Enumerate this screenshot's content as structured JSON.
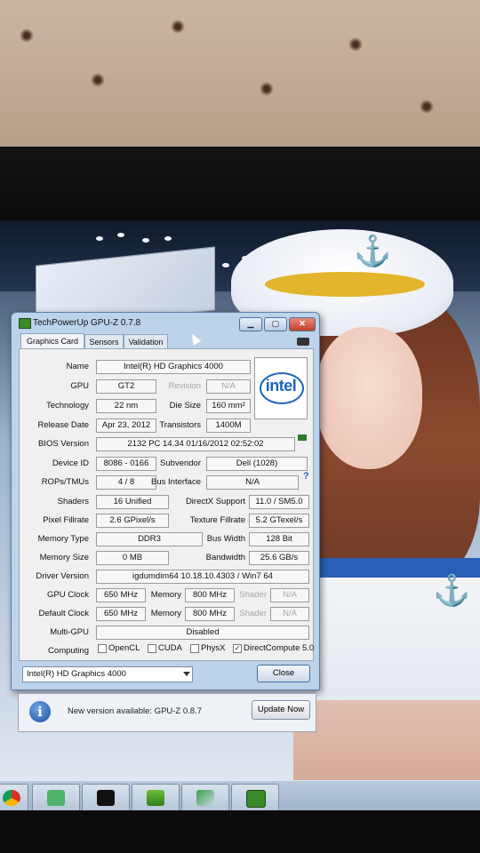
{
  "window": {
    "title": "TechPowerUp GPU-Z 0.7.8",
    "buttons": {
      "minimize": "▁",
      "maximize": "▢",
      "close": "✕"
    }
  },
  "tabs": [
    "Graphics Card",
    "Sensors",
    "Validation"
  ],
  "graphics_card": {
    "name_label": "Name",
    "name": "Intel(R) HD Graphics 4000",
    "gpu_label": "GPU",
    "gpu": "GT2",
    "revision_label": "Revision",
    "revision": "N/A",
    "technology_label": "Technology",
    "technology": "22 nm",
    "die_size_label": "Die Size",
    "die_size": "160 mm²",
    "release_date_label": "Release Date",
    "release_date": "Apr 23, 2012",
    "transistors_label": "Transistors",
    "transistors": "1400M",
    "bios_label": "BIOS Version",
    "bios": "2132 PC 14.34 01/16/2012 02:52:02",
    "device_id_label": "Device ID",
    "device_id": "8086 - 0166",
    "subvendor_label": "Subvendor",
    "subvendor": "Dell (1028)",
    "rops_label": "ROPs/TMUs",
    "rops": "4 / 8",
    "bus_label": "Bus Interface",
    "bus": "N/A",
    "shaders_label": "Shaders",
    "shaders": "16 Unified",
    "directx_label": "DirectX Support",
    "directx": "11.0 / SM5.0",
    "pixel_fillrate_label": "Pixel Fillrate",
    "pixel_fillrate": "2.6 GPixel/s",
    "texture_fillrate_label": "Texture Fillrate",
    "texture_fillrate": "5.2 GTexel/s",
    "memory_type_label": "Memory Type",
    "memory_type": "DDR3",
    "bus_width_label": "Bus Width",
    "bus_width": "128 Bit",
    "memory_size_label": "Memory Size",
    "memory_size": "0 MB",
    "bandwidth_label": "Bandwidth",
    "bandwidth": "25.6 GB/s",
    "driver_label": "Driver Version",
    "driver": "igdumdim64 10.18.10.4303 / Win7 64",
    "gpu_clock_label": "GPU Clock",
    "gpu_clock": "650 MHz",
    "memory_label": "Memory",
    "memory_clock": "800 MHz",
    "shader_label": "Shader",
    "shader_clock": "N/A",
    "default_clock_label": "Default Clock",
    "default_clock": "650 MHz",
    "default_memory_clock": "800 MHz",
    "default_shader_clock": "N/A",
    "multigpu_label": "Multi-GPU",
    "multigpu": "Disabled",
    "computing_label": "Computing",
    "opencl_label": "OpenCL",
    "opencl_checked": false,
    "cuda_label": "CUDA",
    "cuda_checked": false,
    "physx_label": "PhysX",
    "physx_checked": false,
    "directcompute_label": "DirectCompute 5.0",
    "directcompute_checked": true,
    "check_mark": "✓",
    "vendor_logo_text": "intel"
  },
  "footer": {
    "selected_gpu": "Intel(R) HD Graphics 4000",
    "close_label": "Close"
  },
  "notification": {
    "icon_glyph": "i",
    "text": "New version available: GPU-Z 0.8.7",
    "button": "Update Now"
  },
  "taskbar": {
    "items": [
      "chrome-icon",
      "folder-icon",
      "console-icon",
      "download-icon",
      "tool-icon",
      "gpu-z-icon"
    ]
  },
  "colors": {
    "intel_blue": "#1a65b8",
    "window_frame": "#bcd3ea",
    "close_red": "#c2412b"
  }
}
